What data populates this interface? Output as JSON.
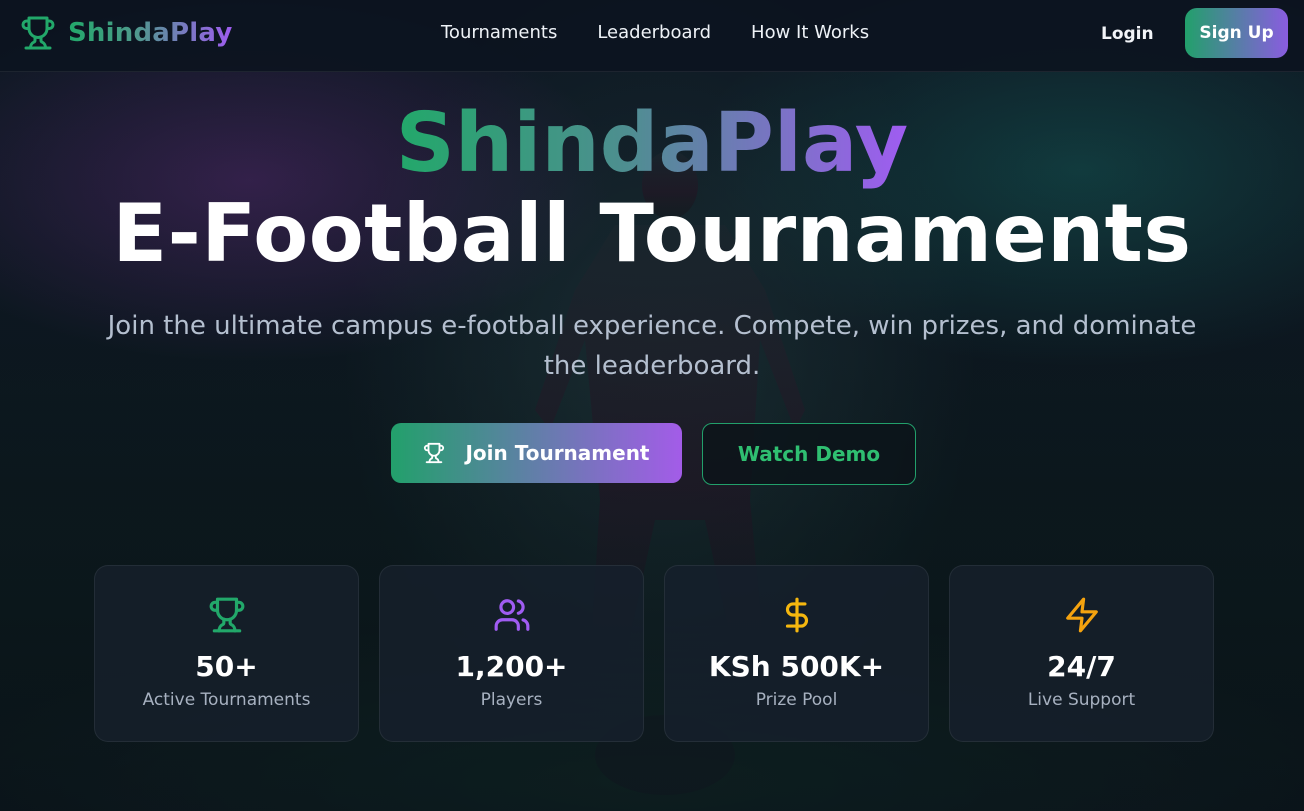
{
  "nav": {
    "brand": "ShindaPlay",
    "links": [
      "Tournaments",
      "Leaderboard",
      "How It Works"
    ],
    "login": "Login",
    "signup": "Sign Up"
  },
  "hero": {
    "brand": "ShindaPlay",
    "title": "E-Football Tournaments",
    "subtitle": "Join the ultimate campus e-football experience. Compete, win prizes, and dominate the leaderboard.",
    "join_button": "Join Tournament",
    "demo_button": "Watch Demo"
  },
  "stats": [
    {
      "icon": "trophy-icon",
      "value": "50+",
      "label": "Active Tournaments",
      "color": "#22a86a"
    },
    {
      "icon": "users-icon",
      "value": "1,200+",
      "label": "Players",
      "color": "#a05cf2"
    },
    {
      "icon": "dollar-icon",
      "value": "KSh 500K+",
      "label": "Prize Pool",
      "color": "#f5b70f"
    },
    {
      "icon": "lightning-icon",
      "value": "24/7",
      "label": "Live Support",
      "color": "#f5a30f"
    }
  ],
  "colors": {
    "brand_green": "#22a86a",
    "brand_purple": "#a05cf2",
    "background": "#0b1220"
  }
}
